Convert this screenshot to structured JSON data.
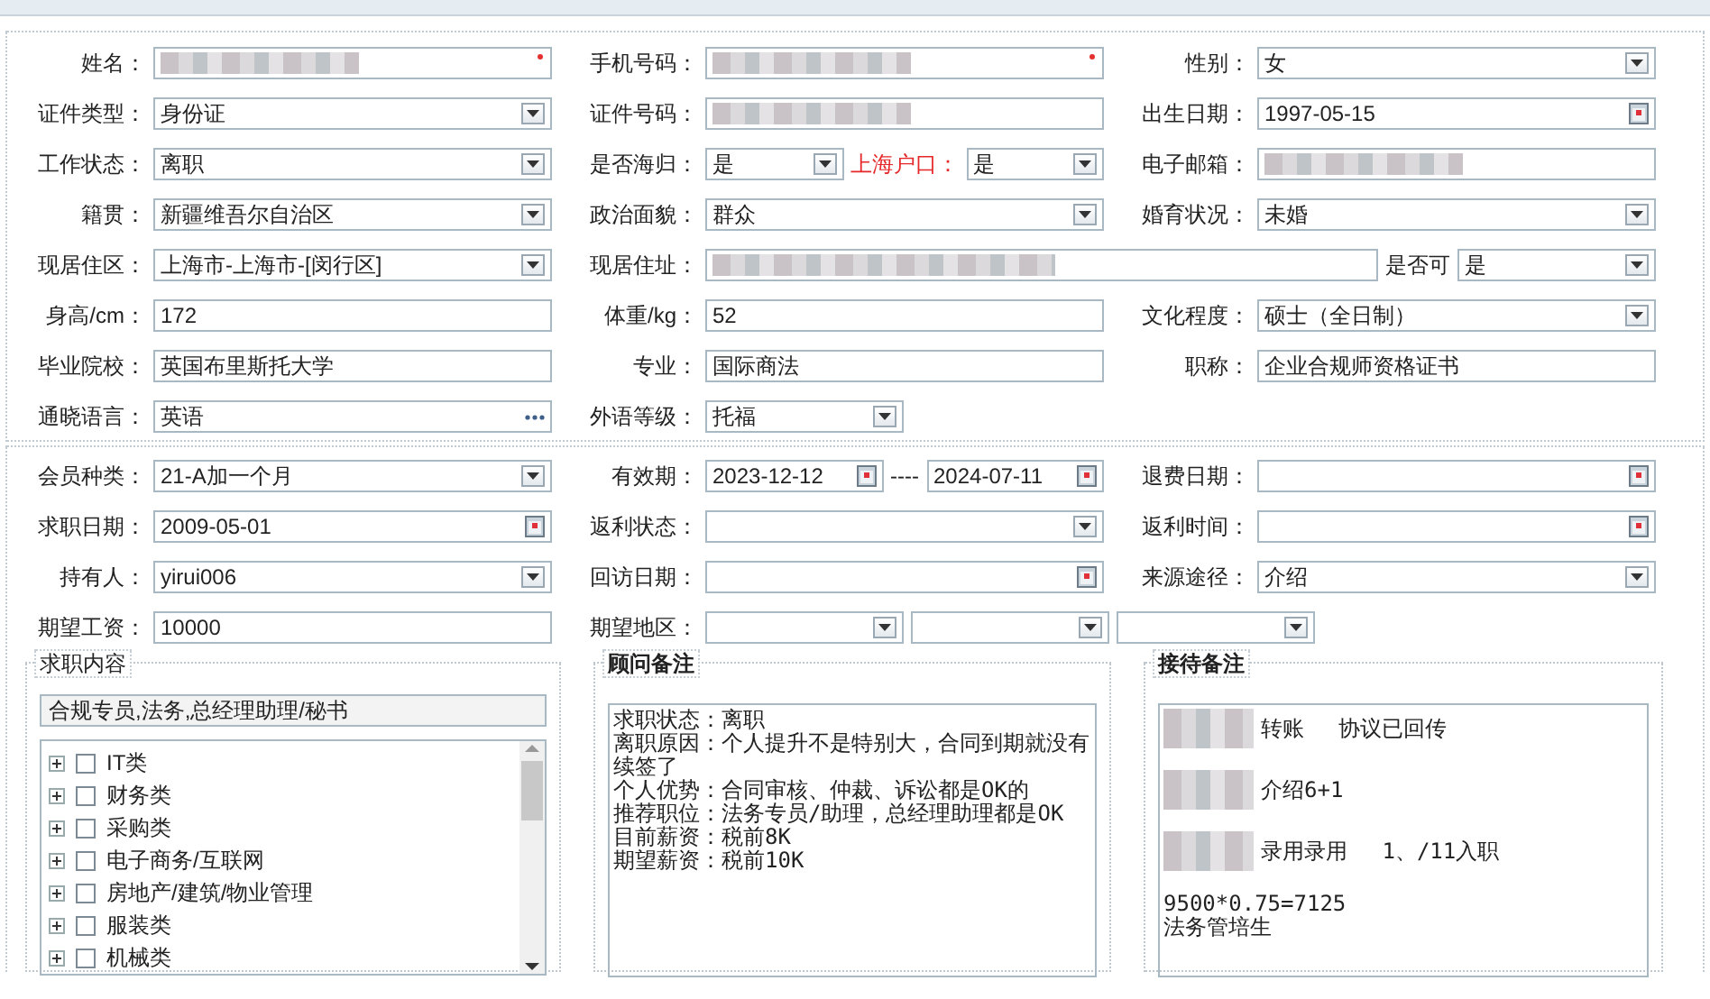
{
  "basic_info": {
    "rows": [
      {
        "cells": [
          {
            "label": "姓名：",
            "controls": [
              {
                "kind": "redacted",
                "required": true
              }
            ]
          },
          {
            "label": "手机号码：",
            "controls": [
              {
                "kind": "redacted",
                "required": true
              }
            ]
          },
          {
            "label": "性别：",
            "controls": [
              {
                "kind": "select",
                "value": "女"
              }
            ]
          }
        ]
      },
      {
        "cells": [
          {
            "label": "证件类型：",
            "controls": [
              {
                "kind": "select",
                "value": "身份证"
              }
            ]
          },
          {
            "label": "证件号码：",
            "controls": [
              {
                "kind": "redacted"
              }
            ]
          },
          {
            "label": "出生日期：",
            "controls": [
              {
                "kind": "date",
                "value": "1997-05-15"
              }
            ]
          }
        ]
      },
      {
        "cells": [
          {
            "label": "工作状态：",
            "controls": [
              {
                "kind": "select",
                "value": "离职"
              }
            ]
          },
          {
            "label": "是否海归：",
            "controls": [
              {
                "kind": "select",
                "value": "是"
              },
              {
                "kind": "label",
                "text": "上海户口：",
                "highlight": true
              },
              {
                "kind": "select",
                "value": "是"
              }
            ]
          },
          {
            "label": "电子邮箱：",
            "controls": [
              {
                "kind": "redacted"
              }
            ]
          }
        ]
      },
      {
        "cells": [
          {
            "label": "籍贯：",
            "controls": [
              {
                "kind": "select",
                "value": "新疆维吾尔自治区"
              }
            ]
          },
          {
            "label": "政治面貌：",
            "controls": [
              {
                "kind": "select",
                "value": "群众"
              }
            ]
          },
          {
            "label": "婚育状况：",
            "controls": [
              {
                "kind": "select",
                "value": "未婚"
              }
            ]
          }
        ]
      },
      {
        "cells": [
          {
            "label": "现居住区：",
            "controls": [
              {
                "kind": "select",
                "value": "上海市-上海市-[闵行区]"
              }
            ]
          },
          {
            "label": "现居住址：",
            "controls": [
              {
                "kind": "redacted"
              },
              {
                "kind": "label",
                "text": "是否可",
                "highlight": false
              },
              {
                "kind": "select",
                "value": "是"
              }
            ]
          }
        ]
      },
      {
        "cells": [
          {
            "label": "身高/cm：",
            "controls": [
              {
                "kind": "text",
                "value": "172"
              }
            ]
          },
          {
            "label": "体重/kg：",
            "controls": [
              {
                "kind": "text",
                "value": "52"
              }
            ]
          },
          {
            "label": "文化程度：",
            "controls": [
              {
                "kind": "select",
                "value": "硕士（全日制）"
              }
            ]
          }
        ]
      },
      {
        "cells": [
          {
            "label": "毕业院校：",
            "controls": [
              {
                "kind": "text",
                "value": "英国布里斯托大学"
              }
            ]
          },
          {
            "label": "专业：",
            "controls": [
              {
                "kind": "text",
                "value": "国际商法"
              }
            ]
          },
          {
            "label": "职称：",
            "controls": [
              {
                "kind": "text",
                "value": "企业合规师资格证书"
              }
            ]
          }
        ]
      },
      {
        "cells": [
          {
            "label": "通晓语言：",
            "controls": [
              {
                "kind": "lookup",
                "value": "英语"
              }
            ]
          },
          {
            "label": "外语等级：",
            "controls": [
              {
                "kind": "select",
                "value": "托福"
              }
            ]
          }
        ]
      }
    ]
  },
  "membership": {
    "rows": [
      {
        "cells": [
          {
            "label": "会员种类：",
            "controls": [
              {
                "kind": "select",
                "value": "21-A加一个月"
              }
            ]
          },
          {
            "label": "有效期：",
            "controls": [
              {
                "kind": "date",
                "value": "2023-12-12"
              },
              {
                "kind": "separator",
                "text": "----"
              },
              {
                "kind": "date",
                "value": "2024-07-11"
              }
            ]
          },
          {
            "label": "退费日期：",
            "controls": [
              {
                "kind": "date"
              }
            ]
          }
        ]
      },
      {
        "cells": [
          {
            "label": "求职日期：",
            "controls": [
              {
                "kind": "date",
                "value": "2009-05-01"
              }
            ]
          },
          {
            "label": "返利状态：",
            "controls": [
              {
                "kind": "select"
              }
            ]
          },
          {
            "label": "返利时间：",
            "controls": [
              {
                "kind": "date"
              }
            ]
          }
        ]
      },
      {
        "cells": [
          {
            "label": "持有人：",
            "controls": [
              {
                "kind": "select",
                "value": "yirui006"
              }
            ]
          },
          {
            "label": "回访日期：",
            "controls": [
              {
                "kind": "date"
              }
            ]
          },
          {
            "label": "来源途径：",
            "controls": [
              {
                "kind": "select",
                "value": "介绍"
              }
            ]
          }
        ]
      },
      {
        "cells": [
          {
            "label": "期望工资：",
            "controls": [
              {
                "kind": "text",
                "value": "10000"
              }
            ]
          },
          {
            "label": "期望地区：",
            "controls": [
              {
                "kind": "select"
              },
              {
                "kind": "select"
              },
              {
                "kind": "select"
              }
            ]
          }
        ]
      }
    ]
  },
  "job_intent": {
    "legend": "求职内容",
    "selection": "合规专员,法务,总经理助理/秘书",
    "categories": [
      {
        "label": "IT类",
        "checked": false,
        "expanded": false
      },
      {
        "label": "财务类",
        "checked": false,
        "expanded": false
      },
      {
        "label": "采购类",
        "checked": false,
        "expanded": false
      },
      {
        "label": "电子商务/互联网",
        "checked": false,
        "expanded": false
      },
      {
        "label": "房地产/建筑/物业管理",
        "checked": false,
        "expanded": false
      },
      {
        "label": "服装类",
        "checked": false,
        "expanded": false
      },
      {
        "label": "机械类",
        "checked": false,
        "expanded": false
      }
    ]
  },
  "consultant_notes": {
    "legend": "顾问备注",
    "lines": [
      {
        "text": "求职状态：离职"
      },
      {
        "text": "离职原因：个人提升不是特别大，合同到期就没有续签了"
      },
      {
        "text": "个人优势：合同审核、仲裁、诉讼都是OK的"
      },
      {
        "text": "推荐职位：法务专员/助理，总经理助理都是OK"
      },
      {
        "text": "目前薪资：税前8K"
      },
      {
        "text": "期望薪资：税前10K"
      }
    ]
  },
  "reception_notes": {
    "legend": "接待备注",
    "lines": [
      {
        "text": "转账　 协议已回传",
        "redacted": true
      },
      {
        "text": "介绍6+1",
        "redacted": true
      },
      {
        "text": "录用录用　 1、/11入职",
        "redacted": true
      },
      {
        "text": "9500*0.75=7125"
      },
      {
        "text": "法务管培生"
      }
    ]
  }
}
